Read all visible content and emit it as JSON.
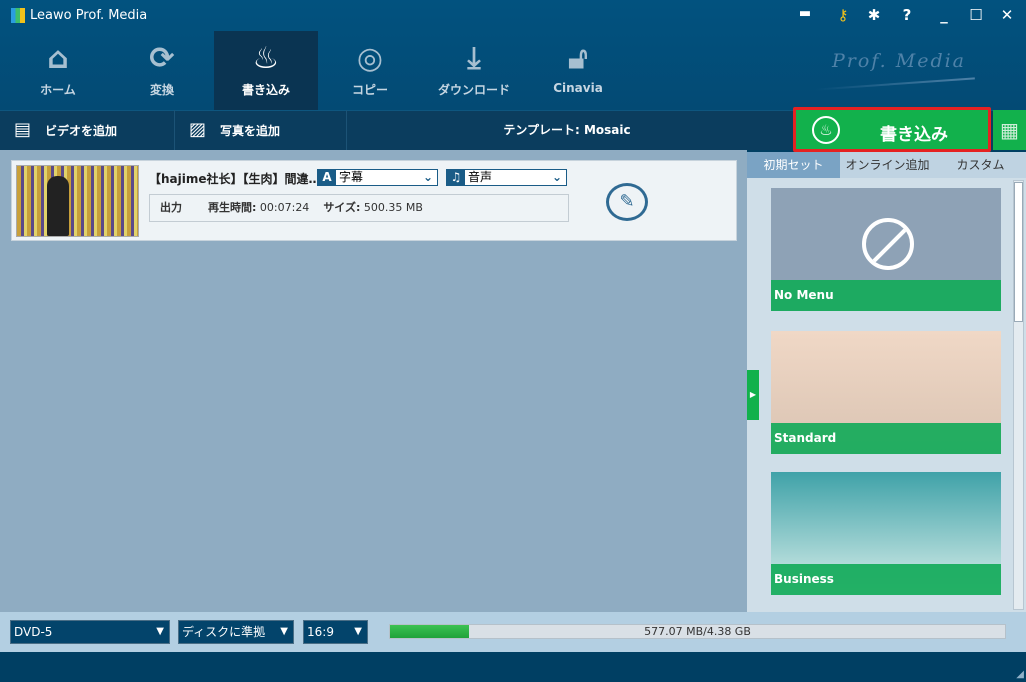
{
  "app": {
    "title": "Leawo Prof. Media",
    "brand": "Prof. Media"
  },
  "window_icons": [
    "chat-icon",
    "key-icon",
    "gear-icon",
    "help-icon",
    "minimize-icon",
    "maximize-icon",
    "close-icon"
  ],
  "nav": [
    {
      "label": "ホーム",
      "icon": "home-icon"
    },
    {
      "label": "変換",
      "icon": "convert-icon"
    },
    {
      "label": "書き込み",
      "icon": "burn-icon",
      "active": true
    },
    {
      "label": "コピー",
      "icon": "copy-icon"
    },
    {
      "label": "ダウンロード",
      "icon": "download-icon"
    },
    {
      "label": "Cinavia",
      "icon": "unlock-icon"
    }
  ],
  "toolbar": {
    "add_video": "ビデオを追加",
    "add_photo": "写真を追加",
    "template": "テンプレート: Mosaic",
    "burn": "書き込み"
  },
  "item": {
    "title": "【hajime社长】【生肉】間違…",
    "subtitle": "字幕",
    "audio": "音声",
    "output": "出力",
    "duration_label": "再生時間:",
    "duration": "00:07:24",
    "size_label": "サイズ:",
    "size": "500.35 MB"
  },
  "right_tabs": [
    "初期セット",
    "オンライン追加",
    "カスタム"
  ],
  "templates": [
    "No Menu",
    "Standard",
    "Business"
  ],
  "footer": {
    "disc": "DVD-5",
    "quality": "ディスクに準拠",
    "aspect": "16:9",
    "usage": "577.07 MB/4.38 GB",
    "progress_percent": 12.9
  },
  "colors": {
    "accent": "#12b14c",
    "highlight": "#e52222"
  }
}
